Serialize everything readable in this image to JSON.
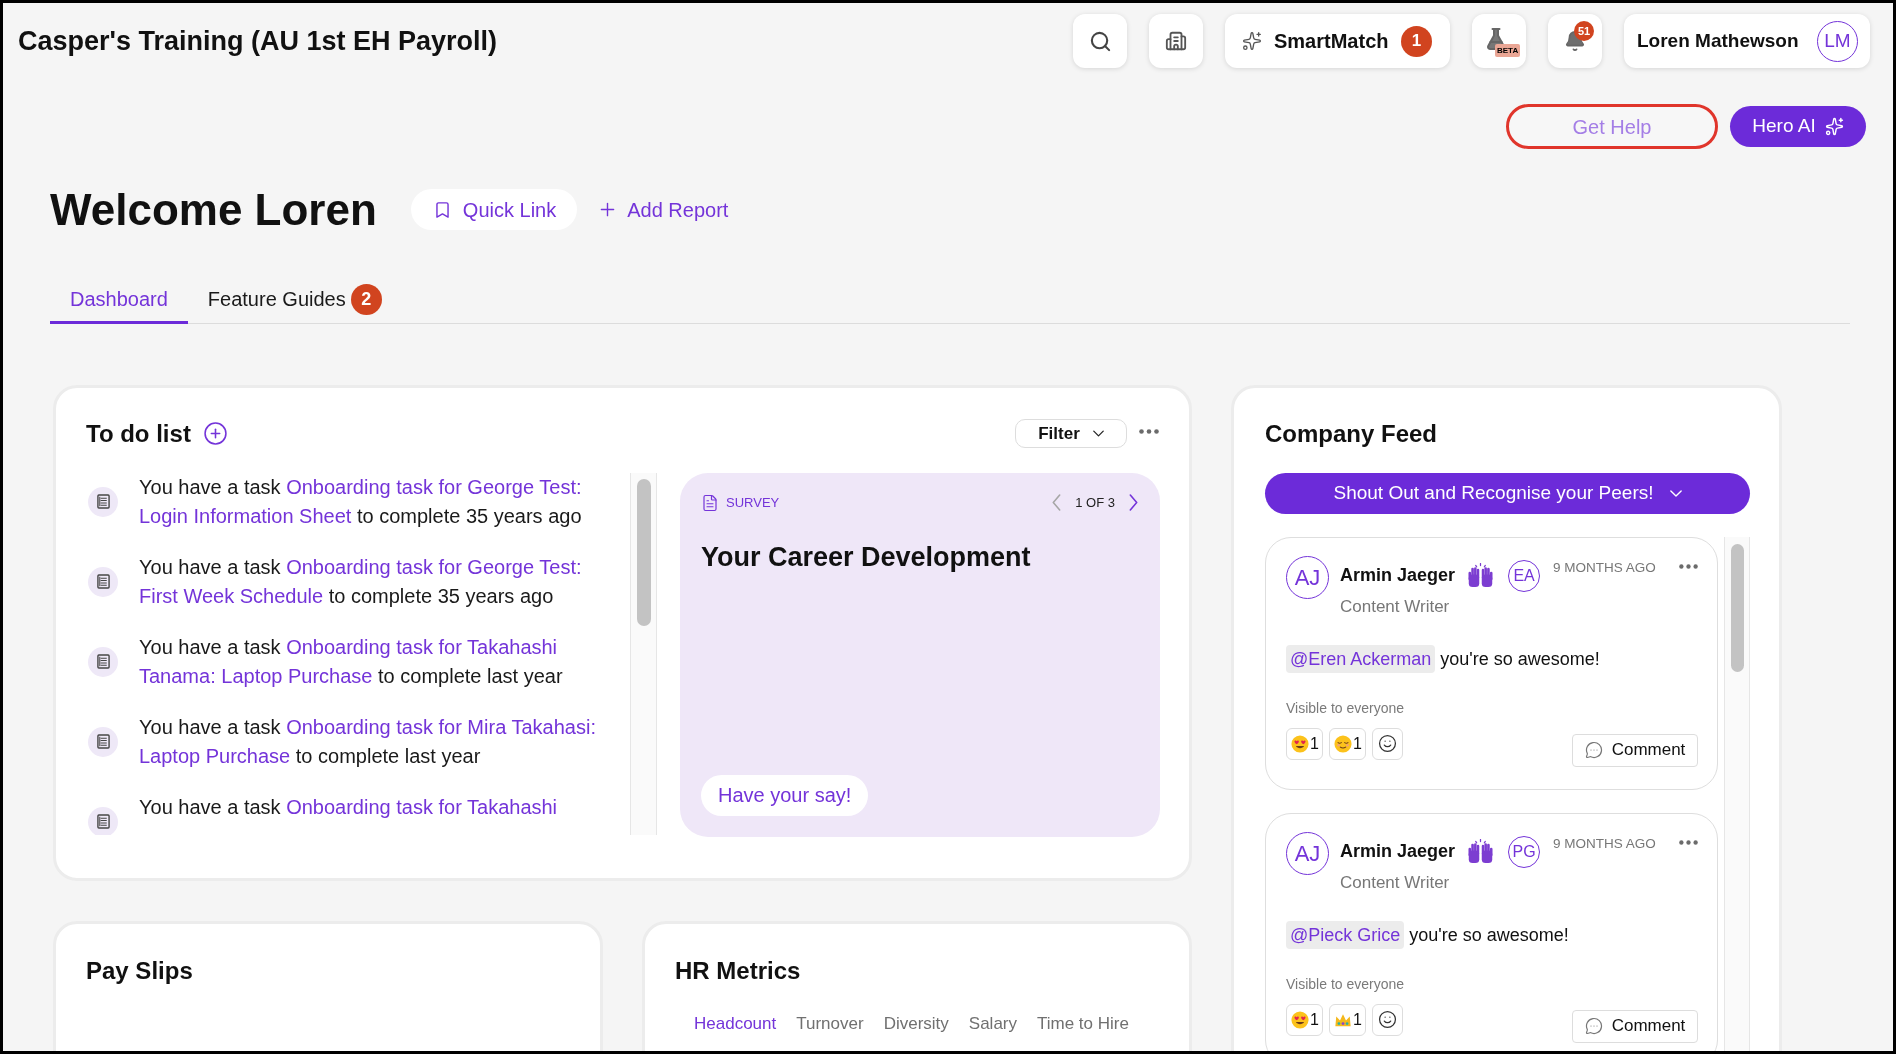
{
  "header": {
    "title": "Casper's Training (AU 1st EH Payroll)",
    "smartmatch": {
      "label": "SmartMatch",
      "badge": "1"
    },
    "labs": {
      "tag": "BETA"
    },
    "notifications": {
      "badge": "51"
    },
    "user": {
      "name": "Loren Mathewson",
      "initials": "LM"
    }
  },
  "help_button": {
    "label": "Get Help",
    "highlighted": true
  },
  "ai_button": {
    "label": "Hero AI"
  },
  "welcome": {
    "title": "Welcome Loren",
    "quick_link": "Quick Link",
    "add_report": "Add Report"
  },
  "tabs": [
    {
      "label": "Dashboard",
      "selected": true
    },
    {
      "label": "Feature Guides",
      "selected": false,
      "badge": "2"
    }
  ],
  "todo": {
    "title": "To do list",
    "filter": "Filter",
    "tasks": [
      {
        "prefix": "You have a task",
        "link_lines": [
          "Onboarding task for George Test:",
          "Login Information Sheet"
        ],
        "suffix": "to complete 35 years ago"
      },
      {
        "prefix": "You have a task",
        "link_lines": [
          "Onboarding task for George Test:",
          "First Week Schedule"
        ],
        "suffix": "to complete 35 years ago"
      },
      {
        "prefix": "You have a task",
        "link_lines": [
          "Onboarding task for Takahashi",
          "Tanama: Laptop Purchase"
        ],
        "suffix": "to complete last year"
      },
      {
        "prefix": "You have a task",
        "link_lines": [
          "Onboarding task for Mira Takahasi:",
          "Laptop Purchase"
        ],
        "suffix": "to complete last year"
      },
      {
        "prefix": "You have a task",
        "link_lines": [
          "Onboarding task for Takahashi"
        ]
      }
    ],
    "survey": {
      "type_label": "SURVEY",
      "pager": {
        "label": "1 OF 3",
        "prev_disabled": true,
        "next_disabled": false
      },
      "title": "Your Career Development",
      "cta": "Have your say!"
    }
  },
  "feed": {
    "title": "Company Feed",
    "shout_out": "Shout Out and Recognise your Peers!",
    "posts": [
      {
        "author_initials": "AJ",
        "author": "Armin Jaeger",
        "recipient_initials": "EA",
        "time": "9 MONTHS AGO",
        "role": "Content Writer",
        "mention": "@Eren Ackerman",
        "message": "you're so awesome!",
        "visibility": "Visible to everyone",
        "reactions": [
          {
            "kind": "hearteyes",
            "count": "1"
          },
          {
            "kind": "relieved",
            "count": "1"
          }
        ],
        "comment": "Comment"
      },
      {
        "author_initials": "AJ",
        "author": "Armin Jaeger",
        "recipient_initials": "PG",
        "time": "9 MONTHS AGO",
        "role": "Content Writer",
        "mention": "@Pieck Grice",
        "message": "you're so awesome!",
        "visibility": "Visible to everyone",
        "reactions": [
          {
            "kind": "hearteyes",
            "count": "1"
          },
          {
            "kind": "crown",
            "count": "1"
          }
        ],
        "comment": "Comment"
      }
    ]
  },
  "pay_slips": {
    "title": "Pay Slips"
  },
  "hr_metrics": {
    "title": "HR Metrics",
    "tabs": [
      {
        "label": "Headcount",
        "selected": true
      },
      {
        "label": "Turnover",
        "selected": false
      },
      {
        "label": "Diversity",
        "selected": false
      },
      {
        "label": "Salary",
        "selected": false
      },
      {
        "label": "Time to Hire",
        "selected": false
      }
    ]
  }
}
